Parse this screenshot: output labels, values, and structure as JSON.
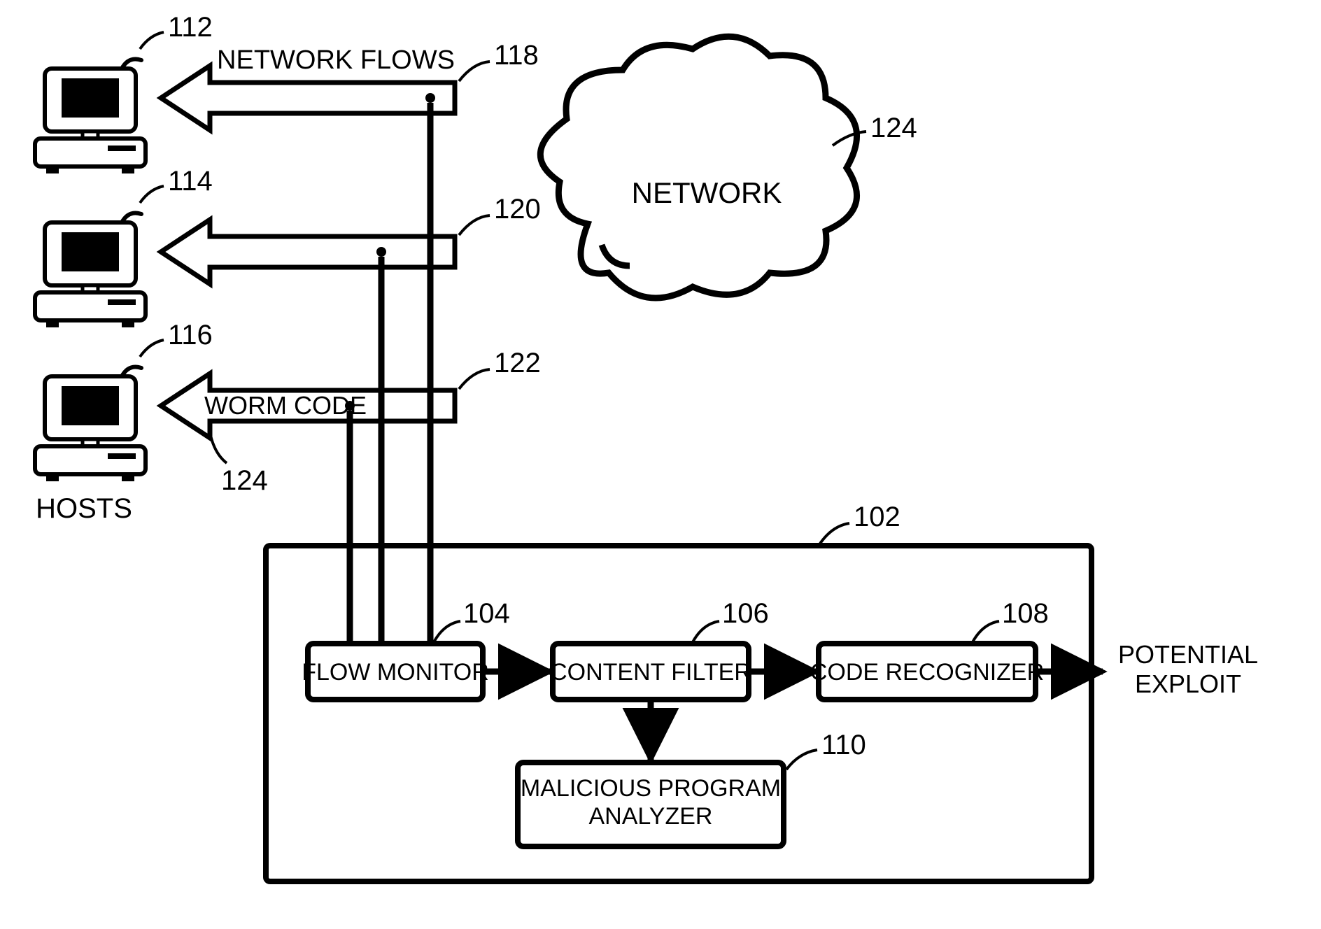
{
  "refs": {
    "host1": "112",
    "host2": "114",
    "host3": "116",
    "arrow1": "118",
    "arrow2": "120",
    "arrow3": "122",
    "arrow3leader": "124",
    "cloud": "124",
    "system": "102",
    "flowmon": "104",
    "cfilter": "106",
    "coderec": "108",
    "analyzer": "110"
  },
  "labels": {
    "hosts": "HOSTS",
    "network": "NETWORK",
    "netflows": "NETWORK FLOWS",
    "wormcode": "WORM CODE",
    "flowmon": "FLOW MONITOR",
    "cfilter": "CONTENT FILTER",
    "coderec": "CODE RECOGNIZER",
    "analyzer_l1": "MALICIOUS PROGRAM",
    "analyzer_l2": "ANALYZER",
    "out_l1": "POTENTIAL",
    "out_l2": "EXPLOIT"
  }
}
